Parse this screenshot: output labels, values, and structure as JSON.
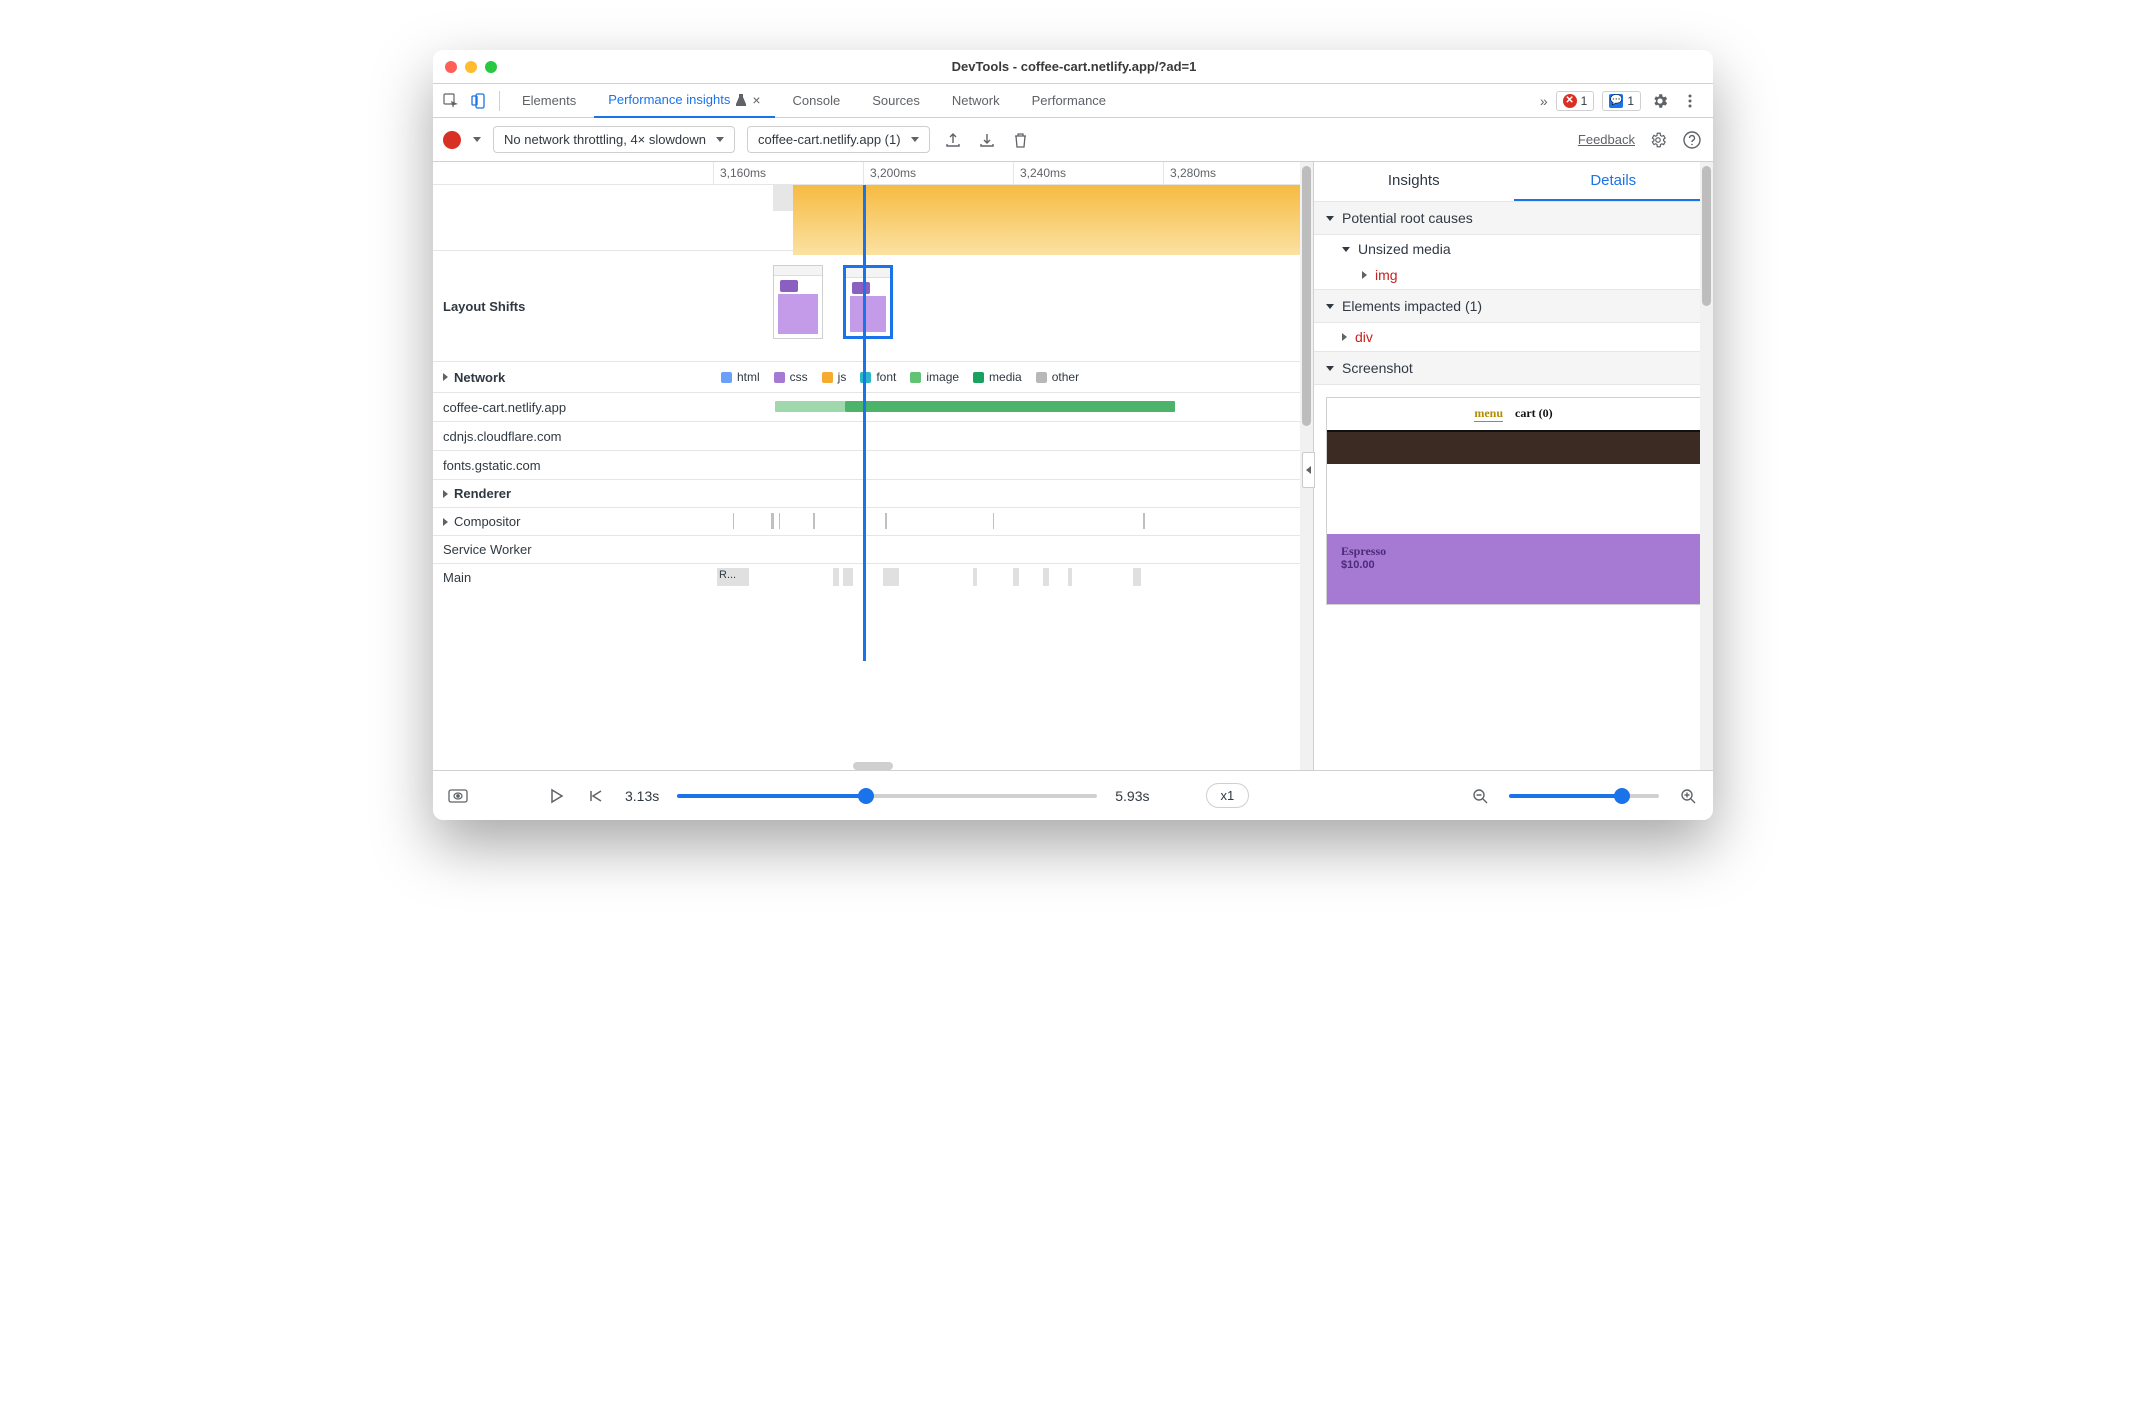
{
  "window": {
    "title": "DevTools - coffee-cart.netlify.app/?ad=1"
  },
  "tabs": {
    "elements": "Elements",
    "perf_insights": "Performance insights",
    "console": "Console",
    "sources": "Sources",
    "network": "Network",
    "performance": "Performance",
    "more": "»",
    "error_count": "1",
    "msg_count": "1"
  },
  "toolbar": {
    "throttle": "No network throttling, 4× slowdown",
    "target": "coffee-cart.netlify.app (1)",
    "feedback": "Feedback"
  },
  "timeline": {
    "ticks": [
      "3,160ms",
      "3,200ms",
      "3,240ms",
      "3,280ms"
    ],
    "layout_shifts": "Layout Shifts",
    "network": "Network",
    "network_hosts": [
      "coffee-cart.netlify.app",
      "cdnjs.cloudflare.com",
      "fonts.gstatic.com"
    ],
    "renderer": "Renderer",
    "compositor": "Compositor",
    "service_worker": "Service Worker",
    "main": "Main",
    "main_block": "R...",
    "legend": {
      "html": "html",
      "css": "css",
      "js": "js",
      "font": "font",
      "image": "image",
      "media": "media",
      "other": "other"
    }
  },
  "colors": {
    "html": "#6aa0f7",
    "css": "#a679d2",
    "js": "#f6ab2e",
    "font": "#29b6c6",
    "image": "#62c374",
    "media": "#19a15f",
    "other": "#b8b8b8"
  },
  "details": {
    "tab_insights": "Insights",
    "tab_details": "Details",
    "root_causes": "Potential root causes",
    "unsized_media": "Unsized media",
    "img": "img",
    "elements_impacted": "Elements impacted (1)",
    "div": "div",
    "screenshot": "Screenshot",
    "shot_menu": "menu",
    "shot_cart": "cart (0)",
    "shot_product": "Espresso",
    "shot_price": "$10.00"
  },
  "bottom": {
    "start": "3.13s",
    "end": "5.93s",
    "speed": "x1"
  }
}
